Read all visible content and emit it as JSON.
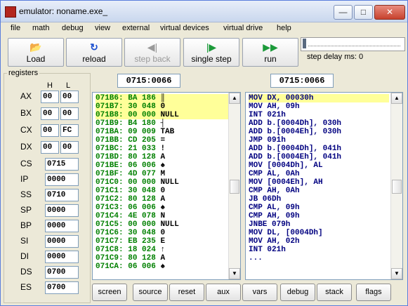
{
  "window": {
    "title": "emulator: noname.exe_"
  },
  "menu": [
    "file",
    "math",
    "debug",
    "view",
    "external",
    "virtual devices",
    "virtual drive",
    "help"
  ],
  "toolbar": {
    "load": "Load",
    "reload": "reload",
    "step_back": "step back",
    "single_step": "single step",
    "run": "run",
    "step_delay": "step delay ms: 0"
  },
  "registers": {
    "title": "registers",
    "h_label": "H",
    "l_label": "L",
    "split": [
      {
        "name": "AX",
        "h": "00",
        "l": "00"
      },
      {
        "name": "BX",
        "h": "00",
        "l": "00"
      },
      {
        "name": "CX",
        "h": "00",
        "l": "FC"
      },
      {
        "name": "DX",
        "h": "00",
        "l": "00"
      }
    ],
    "full": [
      {
        "name": "CS",
        "value": "0715"
      },
      {
        "name": "IP",
        "value": "0000"
      },
      {
        "name": "SS",
        "value": "0710"
      },
      {
        "name": "SP",
        "value": "0000"
      },
      {
        "name": "BP",
        "value": "0000"
      },
      {
        "name": "SI",
        "value": "0000"
      },
      {
        "name": "DI",
        "value": "0000"
      },
      {
        "name": "DS",
        "value": "0700"
      },
      {
        "name": "ES",
        "value": "0700"
      }
    ]
  },
  "memory_address": "0715:0066",
  "disasm_address": "0715:0066",
  "memory_rows": [
    {
      "addr": "071B6:",
      "hex": "BA",
      "dec": "186",
      "ch": "║",
      "hl": true
    },
    {
      "addr": "071B7:",
      "hex": "30",
      "dec": "048",
      "ch": "0",
      "hl": true
    },
    {
      "addr": "071B8:",
      "hex": "00",
      "dec": "000",
      "ch": "NULL",
      "hl": true
    },
    {
      "addr": "071B9:",
      "hex": "B4",
      "dec": "180",
      "ch": "┤",
      "hl": false
    },
    {
      "addr": "071BA:",
      "hex": "09",
      "dec": "009",
      "ch": "TAB",
      "hl": false
    },
    {
      "addr": "071BB:",
      "hex": "CD",
      "dec": "205",
      "ch": "=",
      "hl": false
    },
    {
      "addr": "071BC:",
      "hex": "21",
      "dec": "033",
      "ch": "!",
      "hl": false
    },
    {
      "addr": "071BD:",
      "hex": "80",
      "dec": "128",
      "ch": "A",
      "hl": false
    },
    {
      "addr": "071BE:",
      "hex": "06",
      "dec": "006",
      "ch": "♠",
      "hl": false
    },
    {
      "addr": "071BF:",
      "hex": "4D",
      "dec": "077",
      "ch": "M",
      "hl": false
    },
    {
      "addr": "071C0:",
      "hex": "00",
      "dec": "000",
      "ch": "NULL",
      "hl": false
    },
    {
      "addr": "071C1:",
      "hex": "30",
      "dec": "048",
      "ch": "0",
      "hl": false
    },
    {
      "addr": "071C2:",
      "hex": "80",
      "dec": "128",
      "ch": "A",
      "hl": false
    },
    {
      "addr": "071C3:",
      "hex": "06",
      "dec": "006",
      "ch": "♠",
      "hl": false
    },
    {
      "addr": "071C4:",
      "hex": "4E",
      "dec": "078",
      "ch": "N",
      "hl": false
    },
    {
      "addr": "071C5:",
      "hex": "00",
      "dec": "000",
      "ch": "NULL",
      "hl": false
    },
    {
      "addr": "071C6:",
      "hex": "30",
      "dec": "048",
      "ch": "0",
      "hl": false
    },
    {
      "addr": "071C7:",
      "hex": "EB",
      "dec": "235",
      "ch": "E",
      "hl": false
    },
    {
      "addr": "071C8:",
      "hex": "18",
      "dec": "024",
      "ch": "↑",
      "hl": false
    },
    {
      "addr": "071C9:",
      "hex": "80",
      "dec": "128",
      "ch": "A",
      "hl": false
    },
    {
      "addr": "071CA:",
      "hex": "06",
      "dec": "006",
      "ch": "♠",
      "hl": false
    }
  ],
  "disasm_rows": [
    {
      "text": "MOV DX, 00030h",
      "hl": true
    },
    {
      "text": "MOV AH, 09h",
      "hl": false
    },
    {
      "text": "INT 021h",
      "hl": false
    },
    {
      "text": "ADD b.[0004Dh], 030h",
      "hl": false
    },
    {
      "text": "ADD b.[0004Eh], 030h",
      "hl": false
    },
    {
      "text": "JMP 091h",
      "hl": false
    },
    {
      "text": "ADD b.[0004Dh], 041h",
      "hl": false
    },
    {
      "text": "ADD b.[0004Eh], 041h",
      "hl": false
    },
    {
      "text": "MOV [0004Dh], AL",
      "hl": false
    },
    {
      "text": "CMP AL, 0Ah",
      "hl": false
    },
    {
      "text": "MOV [0004Eh], AH",
      "hl": false
    },
    {
      "text": "CMP AH, 0Ah",
      "hl": false
    },
    {
      "text": "JB 06Dh",
      "hl": false
    },
    {
      "text": "CMP AL, 09h",
      "hl": false
    },
    {
      "text": "CMP AH, 09h",
      "hl": false
    },
    {
      "text": "JNBE 079h",
      "hl": false
    },
    {
      "text": "MOV DL, [0004Dh]",
      "hl": false
    },
    {
      "text": "MOV AH, 02h",
      "hl": false
    },
    {
      "text": "INT 021h",
      "hl": false
    },
    {
      "text": "...",
      "hl": false
    }
  ],
  "bottom_buttons": [
    "screen",
    "source",
    "reset",
    "aux",
    "vars",
    "debug",
    "stack",
    "flags"
  ],
  "colors": {
    "addr_text": "#008000",
    "code_text": "#000080",
    "highlight": "#ffff99"
  }
}
